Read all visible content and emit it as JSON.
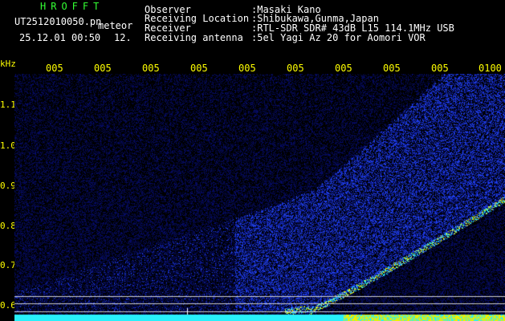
{
  "header": {
    "brand": "HROFFT",
    "filename": "UT2512010050.pn",
    "app_name": "meteor",
    "datetime": "25.12.01 00:50",
    "speed": "12.",
    "info": [
      {
        "label": "Observer",
        "value": ":Masaki Kano"
      },
      {
        "label": "Receiving Location",
        "value": ":Shibukawa,Gunma,Japan"
      },
      {
        "label": "Receiver",
        "value": ":RTL-SDR SDR# 43dB L15 114.1MHz USB"
      },
      {
        "label": "Receiving antenna",
        "value": ":5el Yagi Az 20 for Aomori VOR"
      }
    ]
  },
  "axes": {
    "y_unit": "kHz",
    "y_ticks": [
      "1.1",
      "1.0",
      "0.9",
      "0.8",
      "0.7",
      "0.6"
    ],
    "x_ticks": [
      "005",
      "005",
      "005",
      "005",
      "005",
      "005",
      "005",
      "005",
      "005",
      "0100"
    ]
  },
  "colors": {
    "label_yellow": "#ffff00",
    "brand_green": "#33ff33",
    "noise_dark": "#0a1060",
    "signal_blue": "#2f55ff",
    "signal_cyan": "#30f0ff",
    "signal_yellow": "#f0f000"
  }
}
